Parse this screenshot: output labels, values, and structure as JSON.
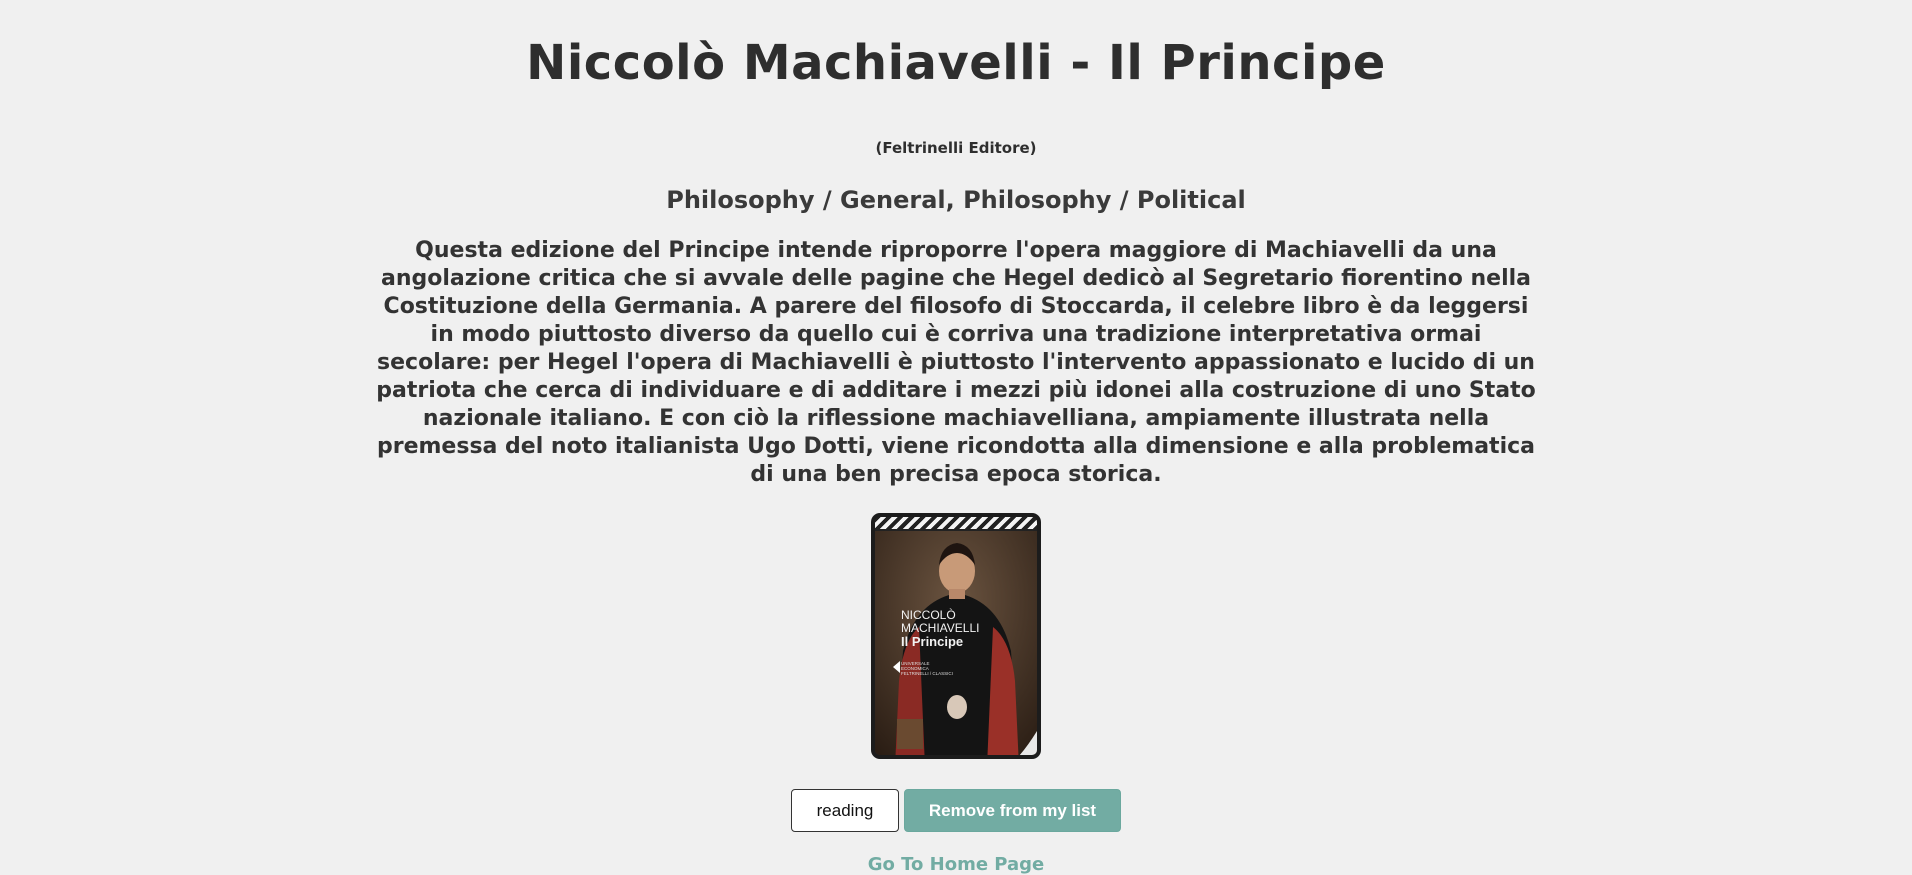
{
  "book": {
    "title": "Niccolò Machiavelli - Il Principe",
    "publisher": "(Feltrinelli Editore)",
    "categories": "Philosophy / General, Philosophy / Political",
    "description": "Questa edizione del Principe intende riproporre l'opera maggiore di Machiavelli da una angolazione critica che si avvale delle pagine che Hegel dedicò al Segretario fiorentino nella Costituzione della Germania. A parere del filosofo di Stoccarda, il celebre libro è da leggersi in modo piuttosto diverso da quello cui è corriva una tradizione interpretativa ormai secolare: per Hegel l'opera di Machiavelli è piuttosto l'intervento appassionato e lucido di un patriota che cerca di individuare e di additare i mezzi più idonei alla costruzione di uno Stato nazionale italiano. E con ciò la riflessione machiavelliana, ampiamente illustrata nella premessa del noto italianista Ugo Dotti, viene ricondotta alla dimensione e alla problematica di una ben precisa epoca storica."
  },
  "cover": {
    "author_line1": "NICCOLÒ",
    "author_line2": "MACHIAVELLI",
    "title": "Il Principe",
    "series_line1": "UNIVERSALE",
    "series_line2": "ECONOMICA",
    "series_line3": "FELTRINELLI / CLASSICI"
  },
  "actions": {
    "status_value": "reading",
    "remove_label": "Remove from my list"
  },
  "nav": {
    "home_label": "Go To Home Page"
  },
  "colors": {
    "accent": "#72aca3",
    "background": "#f0f0f0",
    "text": "#2e2e2e"
  }
}
